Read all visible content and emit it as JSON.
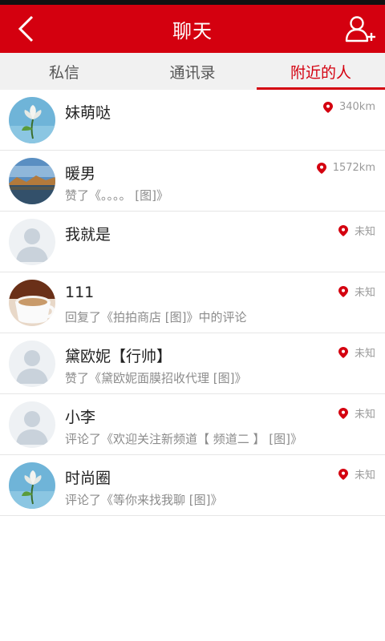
{
  "header": {
    "title": "聊天",
    "back_icon": "back-chevron-icon",
    "action_icon": "add-user-icon"
  },
  "tabs": [
    {
      "label": "私信",
      "active": false
    },
    {
      "label": "通讯录",
      "active": false
    },
    {
      "label": "附近的人",
      "active": true
    }
  ],
  "colors": {
    "accent": "#d4000f",
    "tab_bg": "#f1f1f1",
    "text_secondary": "#8c8c8c"
  },
  "people": [
    {
      "name": "妹萌哒",
      "desc": "",
      "distance": "340km",
      "avatar": "flower"
    },
    {
      "name": "暖男",
      "desc": "赞了《。。。。 [图]》",
      "distance": "1572km",
      "avatar": "lake"
    },
    {
      "name": "我就是",
      "desc": "",
      "distance": "未知",
      "avatar": "default"
    },
    {
      "name": "111",
      "desc": "回复了《拍拍商店 [图]》中的评论",
      "distance": "未知",
      "avatar": "cup"
    },
    {
      "name": "黛欧妮【行帅】",
      "desc": "赞了《黛欧妮面膜招收代理 [图]》",
      "distance": "未知",
      "avatar": "default"
    },
    {
      "name": "小李",
      "desc": "评论了《欢迎关注新频道【 频道二 】 [图]》",
      "distance": "未知",
      "avatar": "default"
    },
    {
      "name": "时尚圈",
      "desc": "评论了《等你来找我聊 [图]》",
      "distance": "未知",
      "avatar": "flower"
    }
  ]
}
